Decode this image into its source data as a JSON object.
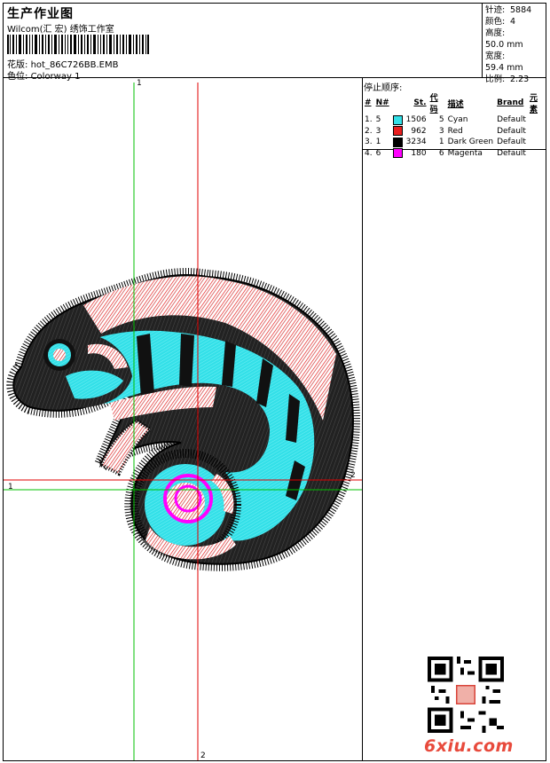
{
  "header": {
    "title": "生产作业图",
    "subtitle": "Wilcom(汇 宏) 绣饰工作室",
    "file_label": "花版:",
    "file_name": "hot_86C726BB.EMB",
    "colorway_label": "色位:",
    "colorway": "Colorway 1"
  },
  "stats": [
    {
      "label": "针迹:",
      "value": "5884"
    },
    {
      "label": "颜色:",
      "value": "4"
    },
    {
      "label": "高度:",
      "value": "50.0 mm"
    },
    {
      "label": "宽度:",
      "value": "59.4 mm"
    },
    {
      "label": "比例:",
      "value": "2.23"
    }
  ],
  "sequence": {
    "title": "停止顺序:",
    "headers": [
      "#",
      "N#",
      "St.",
      "代码",
      "描述",
      "Brand",
      "元素"
    ],
    "rows": [
      {
        "idx": "1.",
        "n": "5",
        "color": "#33e0e8",
        "st": "1506",
        "code": "5",
        "desc": "Cyan",
        "brand": "Default"
      },
      {
        "idx": "2.",
        "n": "3",
        "color": "#e81e1e",
        "st": "962",
        "code": "3",
        "desc": "Red",
        "brand": "Default"
      },
      {
        "idx": "3.",
        "n": "1",
        "color": "#000000",
        "st": "3234",
        "code": "1",
        "desc": "Dark Green",
        "brand": "Default"
      },
      {
        "idx": "4.",
        "n": "6",
        "color": "#ff00ff",
        "st": "180",
        "code": "6",
        "desc": "Magenta",
        "brand": "Default"
      }
    ]
  },
  "axes": {
    "green_v_top": "1",
    "green_h_left": "1",
    "red_h_right": "2",
    "red_v_bottom": "2"
  },
  "watermark": "6xiu.com",
  "colors": {
    "cyan": "#33e0e8",
    "red": "#e81e1e",
    "black": "#000000",
    "magenta": "#ff00ff",
    "green_axis": "#00c000",
    "red_axis": "#e00000"
  }
}
